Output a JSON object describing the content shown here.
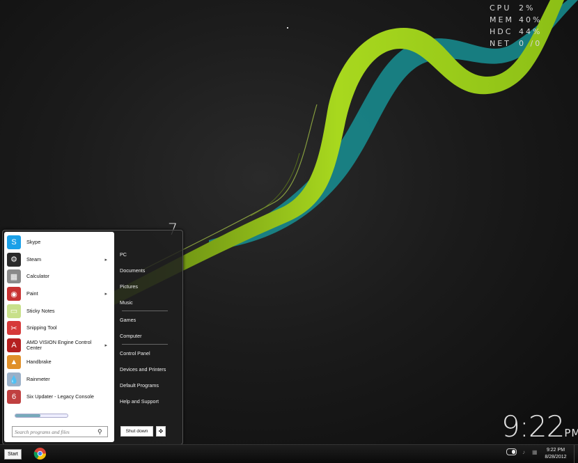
{
  "system_monitor": [
    {
      "label": "CPU",
      "value": "2%"
    },
    {
      "label": "MEM",
      "value": "40%"
    },
    {
      "label": "HDC",
      "value": "44%"
    },
    {
      "label": "NET",
      "value": "0  /0"
    }
  ],
  "desktop_clock": {
    "time": "9:22",
    "ampm": "PM"
  },
  "start_menu": {
    "os_version_mark": "7",
    "programs": [
      {
        "label": "Skype",
        "icon": "skype-icon",
        "color": "#1aa0e8",
        "has_submenu": false
      },
      {
        "label": "Steam",
        "icon": "steam-icon",
        "color": "#2b2b2b",
        "has_submenu": true
      },
      {
        "label": "Calculator",
        "icon": "calculator-icon",
        "color": "#8a8a8a",
        "has_submenu": false
      },
      {
        "label": "Paint",
        "icon": "paint-icon",
        "color": "#c83232",
        "has_submenu": true
      },
      {
        "label": "Sticky Notes",
        "icon": "sticky-notes-icon",
        "color": "#c8e08a",
        "has_submenu": false
      },
      {
        "label": "Snipping Tool",
        "icon": "snipping-tool-icon",
        "color": "#d63a3a",
        "has_submenu": false
      },
      {
        "label": "AMD VISION Engine Control Center",
        "icon": "amd-icon",
        "color": "#b52020",
        "has_submenu": true
      },
      {
        "label": "Handbrake",
        "icon": "handbrake-icon",
        "color": "#e0902a",
        "has_submenu": false
      },
      {
        "label": "Rainmeter",
        "icon": "rainmeter-icon",
        "color": "#9ab0c8",
        "has_submenu": false
      },
      {
        "label": "Six Updater - Legacy Console",
        "icon": "six-updater-icon",
        "color": "#c04040",
        "has_submenu": false
      }
    ],
    "progress_fraction": 0.48,
    "search_placeholder": "Search programs and files",
    "right_items": {
      "pc": "PC",
      "documents": "Documents",
      "pictures": "Pictures",
      "music": "Music",
      "games": "Games",
      "computer": "Computer",
      "control_panel": "Control Panel",
      "devices_printers": "Devices and Printers",
      "default_programs": "Default Programs",
      "help_support": "Help and Support"
    },
    "shutdown_label": "Shut down"
  },
  "taskbar": {
    "start_label": "Start",
    "pinned": [
      {
        "name": "Google Chrome",
        "icon": "chrome-icon"
      }
    ],
    "clock_time": "9:22 PM",
    "clock_date": "8/28/2012"
  },
  "colors": {
    "accent_green": "#9acd1e",
    "accent_teal": "#1aa3a0"
  }
}
